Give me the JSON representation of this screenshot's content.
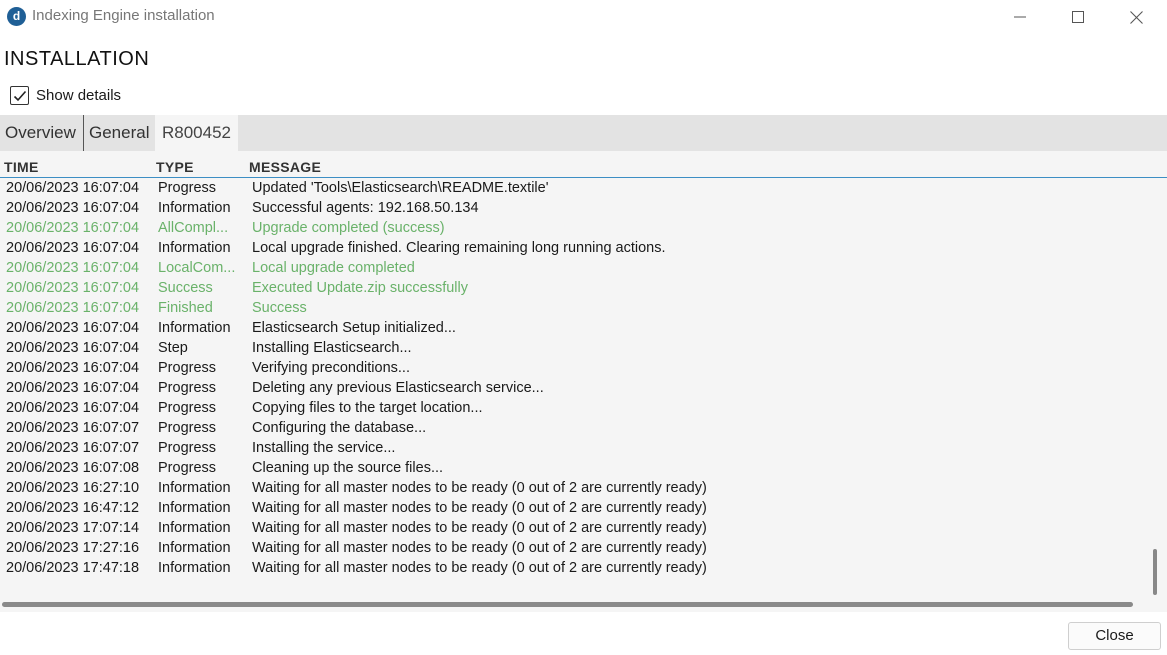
{
  "window": {
    "logo_letter": "d",
    "title": "Indexing Engine installation"
  },
  "heading": "INSTALLATION",
  "show_details": {
    "label": "Show details",
    "checked": true
  },
  "tabs": [
    {
      "label": "Overview",
      "active": false
    },
    {
      "label": "General",
      "active": false
    },
    {
      "label": "R800452",
      "active": true
    }
  ],
  "columns": {
    "time": "TIME",
    "type": "TYPE",
    "message": "MESSAGE"
  },
  "colors": {
    "success_text": "#6ab26a",
    "header_underline": "#3c8ec4"
  },
  "log_rows": [
    {
      "time": "20/06/2023 16:07:04",
      "type": "Progress",
      "message": "Updated 'Tools\\Elasticsearch\\README.textile'",
      "status": "normal"
    },
    {
      "time": "20/06/2023 16:07:04",
      "type": "Information",
      "message": "Successful agents: 192.168.50.134",
      "status": "normal"
    },
    {
      "time": "20/06/2023 16:07:04",
      "type": "AllCompl...",
      "message": "Upgrade completed (success)",
      "status": "success"
    },
    {
      "time": "20/06/2023 16:07:04",
      "type": "Information",
      "message": "Local upgrade finished. Clearing remaining long running actions.",
      "status": "normal"
    },
    {
      "time": "20/06/2023 16:07:04",
      "type": "LocalCom...",
      "message": "Local upgrade completed",
      "status": "success"
    },
    {
      "time": "20/06/2023 16:07:04",
      "type": "Success",
      "message": "Executed Update.zip successfully",
      "status": "success"
    },
    {
      "time": "20/06/2023 16:07:04",
      "type": "Finished",
      "message": "Success",
      "status": "success"
    },
    {
      "time": "20/06/2023 16:07:04",
      "type": "Information",
      "message": "Elasticsearch Setup initialized...",
      "status": "normal"
    },
    {
      "time": "20/06/2023 16:07:04",
      "type": "Step",
      "message": "Installing Elasticsearch...",
      "status": "normal"
    },
    {
      "time": "20/06/2023 16:07:04",
      "type": "Progress",
      "message": "Verifying preconditions...",
      "status": "normal"
    },
    {
      "time": "20/06/2023 16:07:04",
      "type": "Progress",
      "message": "Deleting any previous Elasticsearch service...",
      "status": "normal"
    },
    {
      "time": "20/06/2023 16:07:04",
      "type": "Progress",
      "message": "Copying files to the target location...",
      "status": "normal"
    },
    {
      "time": "20/06/2023 16:07:07",
      "type": "Progress",
      "message": "Configuring the database...",
      "status": "normal"
    },
    {
      "time": "20/06/2023 16:07:07",
      "type": "Progress",
      "message": "Installing the service...",
      "status": "normal"
    },
    {
      "time": "20/06/2023 16:07:08",
      "type": "Progress",
      "message": "Cleaning up the source files...",
      "status": "normal"
    },
    {
      "time": "20/06/2023 16:27:10",
      "type": "Information",
      "message": "Waiting for all master nodes to be ready (0 out of 2 are currently ready)",
      "status": "normal"
    },
    {
      "time": "20/06/2023 16:47:12",
      "type": "Information",
      "message": "Waiting for all master nodes to be ready (0 out of 2 are currently ready)",
      "status": "normal"
    },
    {
      "time": "20/06/2023 17:07:14",
      "type": "Information",
      "message": "Waiting for all master nodes to be ready (0 out of 2 are currently ready)",
      "status": "normal"
    },
    {
      "time": "20/06/2023 17:27:16",
      "type": "Information",
      "message": "Waiting for all master nodes to be ready (0 out of 2 are currently ready)",
      "status": "normal"
    },
    {
      "time": "20/06/2023 17:47:18",
      "type": "Information",
      "message": "Waiting for all master nodes to be ready (0 out of 2 are currently ready)",
      "status": "normal"
    }
  ],
  "footer": {
    "close_label": "Close"
  }
}
